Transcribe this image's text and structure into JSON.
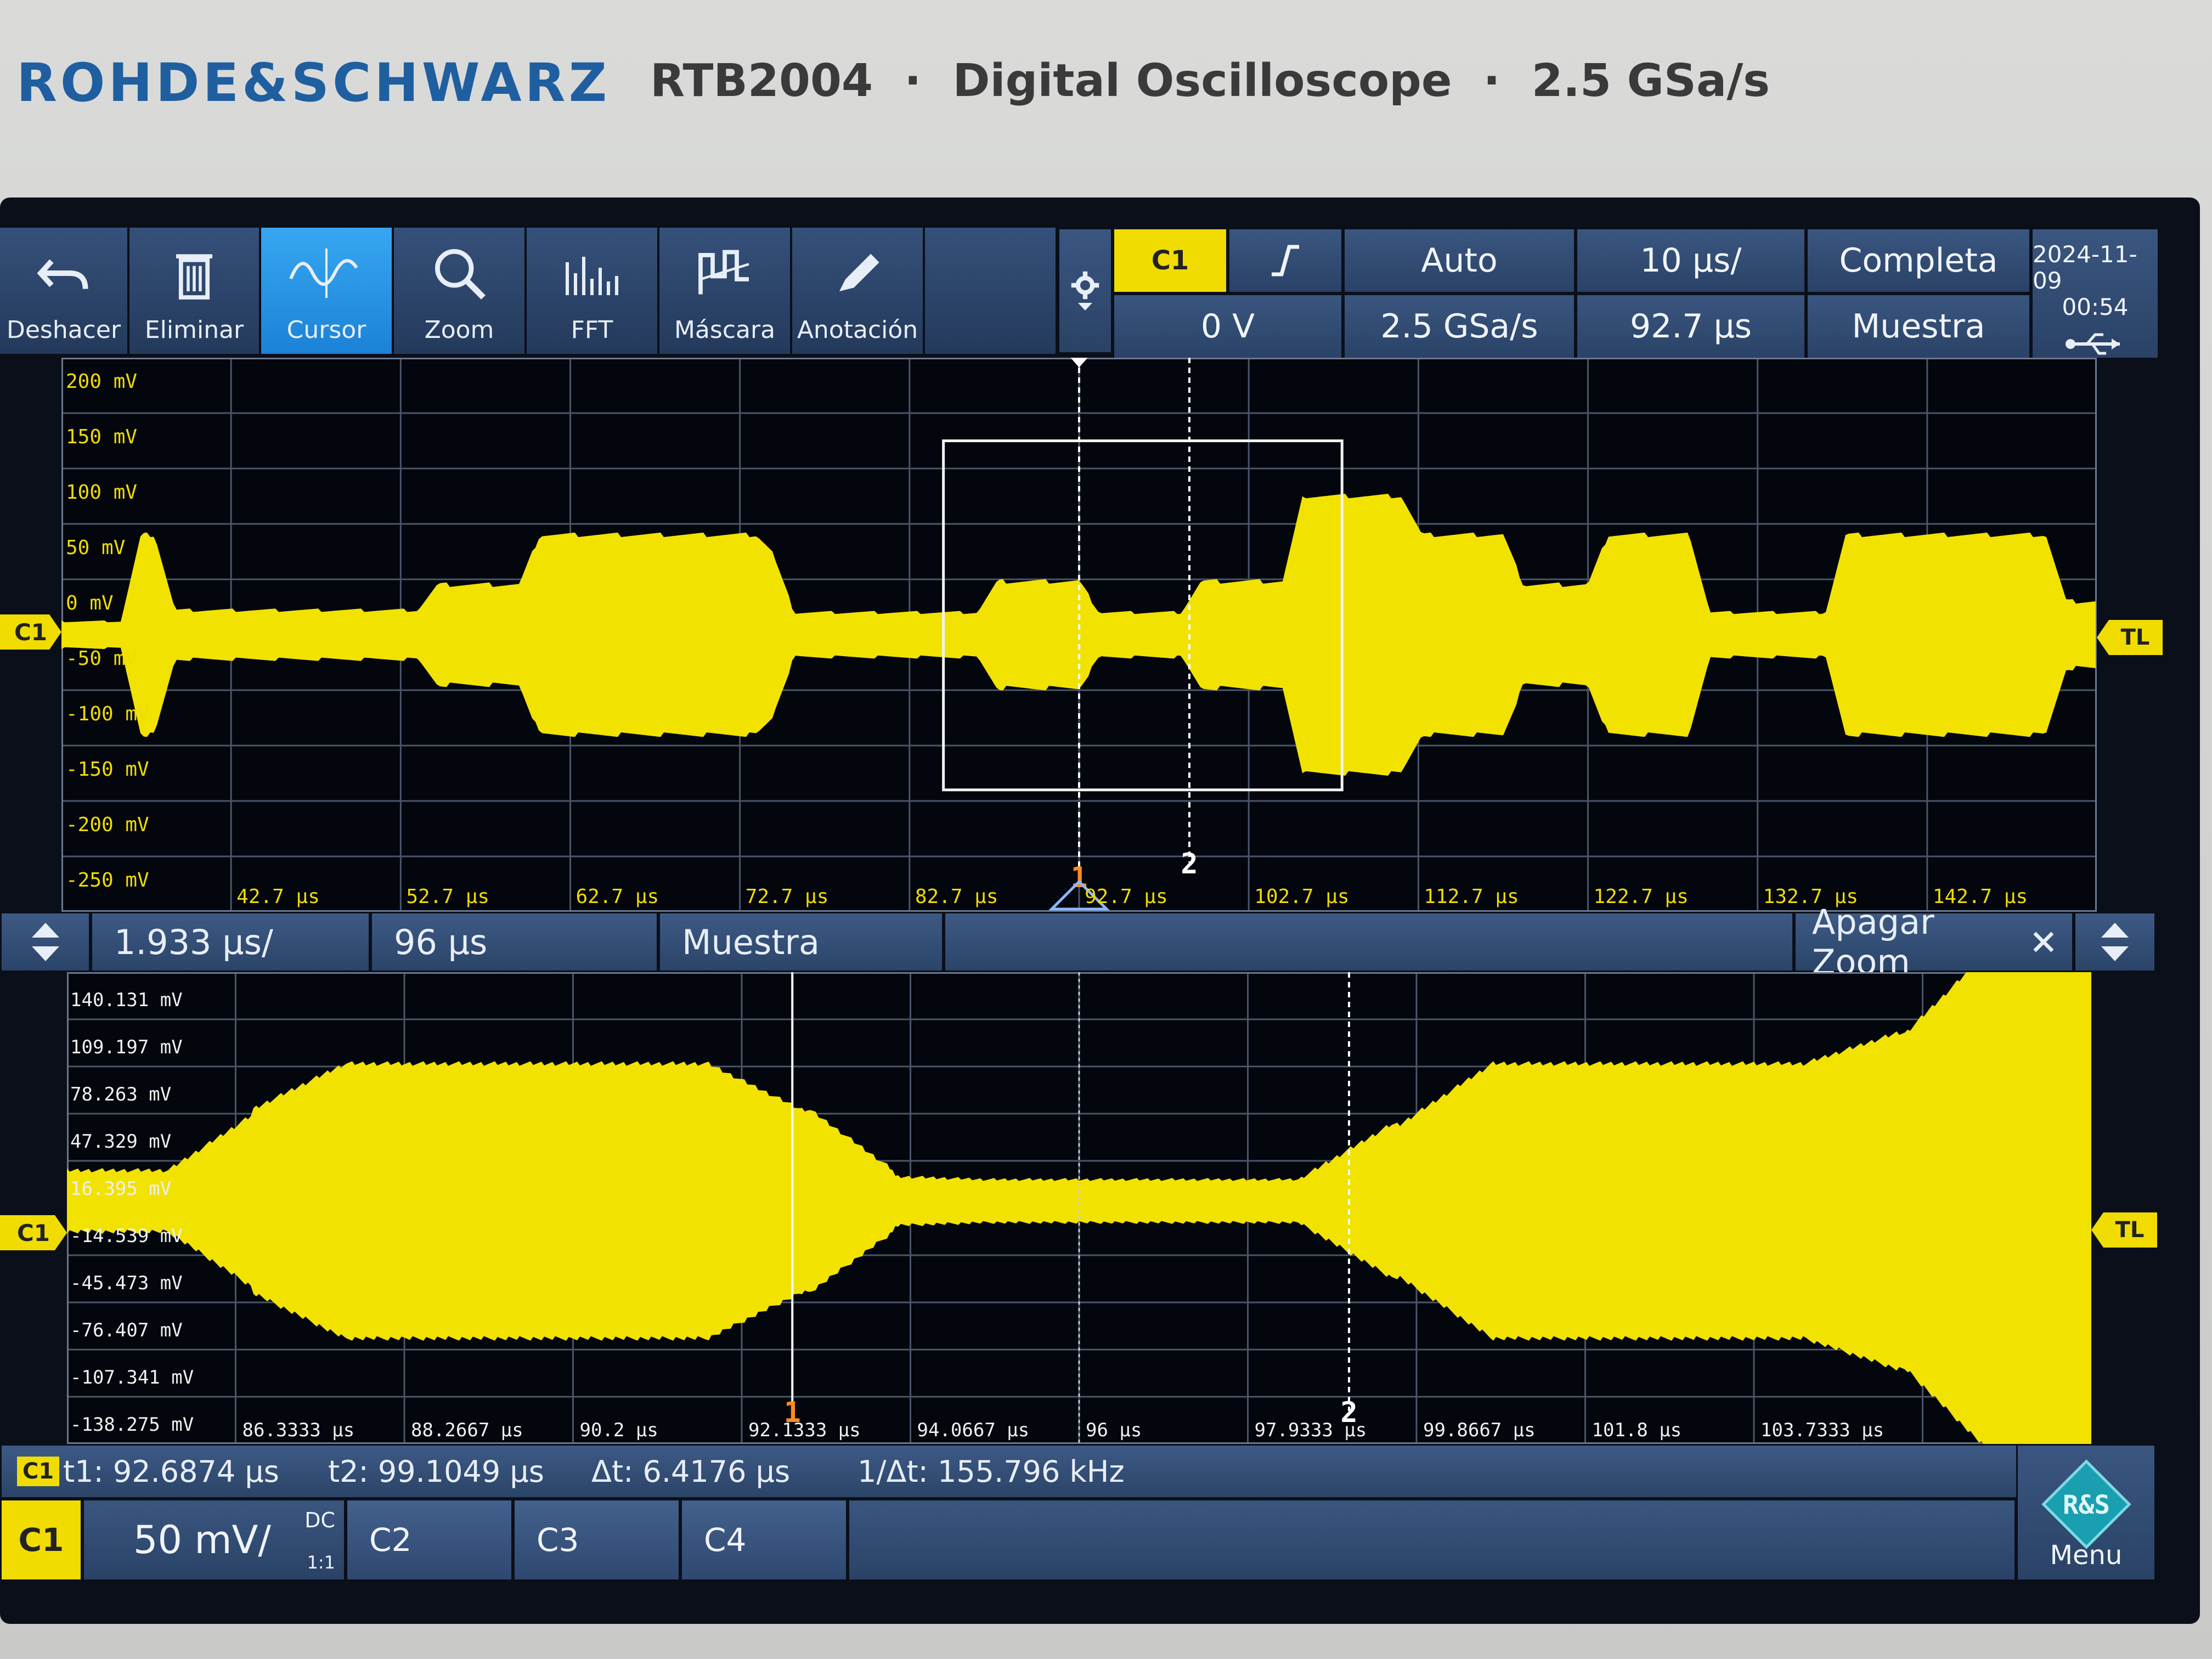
{
  "header": {
    "brand": "ROHDE&SCHWARZ",
    "model_line": "RTB2004  ·  Digital Oscilloscope  ·  2.5 GSa/s"
  },
  "toolbar": {
    "buttons": [
      {
        "label": "Deshacer",
        "icon": "undo-icon",
        "active": false
      },
      {
        "label": "Eliminar",
        "icon": "trash-icon",
        "active": false
      },
      {
        "label": "Cursor",
        "icon": "cursor-wave-icon",
        "active": true
      },
      {
        "label": "Zoom",
        "icon": "magnifier-icon",
        "active": false
      },
      {
        "label": "FFT",
        "icon": "fft-icon",
        "active": false
      },
      {
        "label": "Máscara",
        "icon": "mask-icon",
        "active": false
      },
      {
        "label": "Anotación",
        "icon": "pencil-icon",
        "active": false
      }
    ],
    "settings_icon": "gear-icon"
  },
  "trigger_panel": {
    "channel": "C1",
    "slope_icon": "rising-edge-icon",
    "mode": "Auto",
    "timebase": "10 µs/",
    "level": "0 V",
    "sample_rate": "2.5 GSa/s",
    "position": "92.7 µs",
    "acq_mode": "Completa",
    "acq_type": "Muestra",
    "date": "2024-11-09",
    "time": "00:54",
    "usb_icon": "usb-icon"
  },
  "main_plot": {
    "y_ticks": [
      "200 mV",
      "150 mV",
      "100 mV",
      "50 mV",
      "0 mV",
      "-50 mV",
      "-100 mV",
      "-150 mV",
      "-200 mV",
      "-250 mV"
    ],
    "x_ticks": [
      "42.7 µs",
      "52.7 µs",
      "62.7 µs",
      "72.7 µs",
      "82.7 µs",
      "92.7 µs",
      "102.7 µs",
      "112.7 µs",
      "122.7 µs",
      "132.7 µs",
      "142.7 µs"
    ],
    "channel_marker": "C1",
    "trigger_marker": "TL",
    "cursor1_label": "1",
    "cursor2_label": "2",
    "trace_color": "#f2e200"
  },
  "zoom_bar": {
    "timebase": "1.933 µs/",
    "position": "96 µs",
    "acq_type": "Muestra",
    "off_label": "Apagar Zoom",
    "close_icon": "close-icon"
  },
  "zoom_plot": {
    "y_ticks": [
      "140.131 mV",
      "109.197 mV",
      "78.263 mV",
      "47.329 mV",
      "16.395 mV",
      "-14.539 mV",
      "-45.473 mV",
      "-76.407 mV",
      "-107.341 mV",
      "-138.275 mV"
    ],
    "x_ticks": [
      "86.3333 µs",
      "88.2667 µs",
      "90.2 µs",
      "92.1333 µs",
      "94.0667 µs",
      "96 µs",
      "97.9333 µs",
      "99.8667 µs",
      "101.8 µs",
      "103.7333 µs"
    ],
    "channel_marker": "C1",
    "trigger_marker": "TL",
    "cursor1_label": "1",
    "cursor2_label": "2"
  },
  "measurements": {
    "channel": "C1",
    "t1": "t1: 92.6874 µs",
    "t2": "t2: 99.1049 µs",
    "dt": "Δt: 6.4176 µs",
    "inv_dt": "1/Δt: 155.796 kHz"
  },
  "channels": {
    "c1": {
      "label": "C1",
      "scale": "50 mV/",
      "coupling": "DC",
      "probe": "1:1"
    },
    "c2": {
      "label": "C2"
    },
    "c3": {
      "label": "C3"
    },
    "c4": {
      "label": "C4"
    },
    "menu_label": "Menu",
    "menu_logo": "R&S",
    "accent": "#f0dc00"
  }
}
